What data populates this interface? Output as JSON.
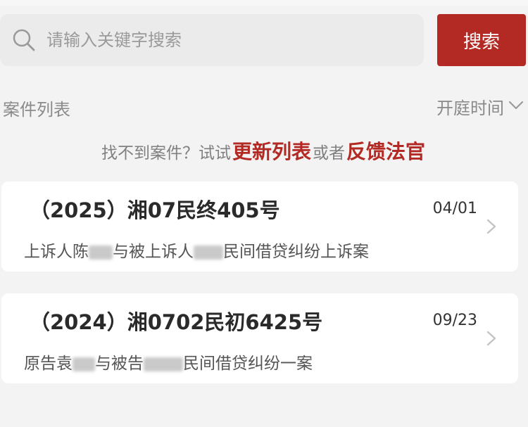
{
  "search": {
    "placeholder": "请输入关键字搜索",
    "button_label": "搜索"
  },
  "list": {
    "title": "案件列表",
    "sort_label": "开庭时间"
  },
  "hint": {
    "prefix": "找不到案件？试试",
    "link_refresh": "更新列表",
    "middle": "或者",
    "link_feedback": "反馈法官"
  },
  "cases": [
    {
      "number": "（2025）湘07民终405号",
      "date": "04/01",
      "desc_a": "上诉人陈",
      "desc_b": "与被上诉人",
      "desc_c": "民间借贷纠纷上诉案"
    },
    {
      "number": "（2024）湘0702民初6425号",
      "date": "09/23",
      "desc_a": "原告袁",
      "desc_b": "与被告",
      "desc_c": "民间借贷纠纷一案"
    }
  ],
  "icons": {
    "search": "search-icon",
    "sort": "chevron-down-icon",
    "row": "chevron-right-icon"
  },
  "colors": {
    "accent": "#b32a24",
    "background": "#f3f3f3",
    "card": "#ffffff"
  }
}
